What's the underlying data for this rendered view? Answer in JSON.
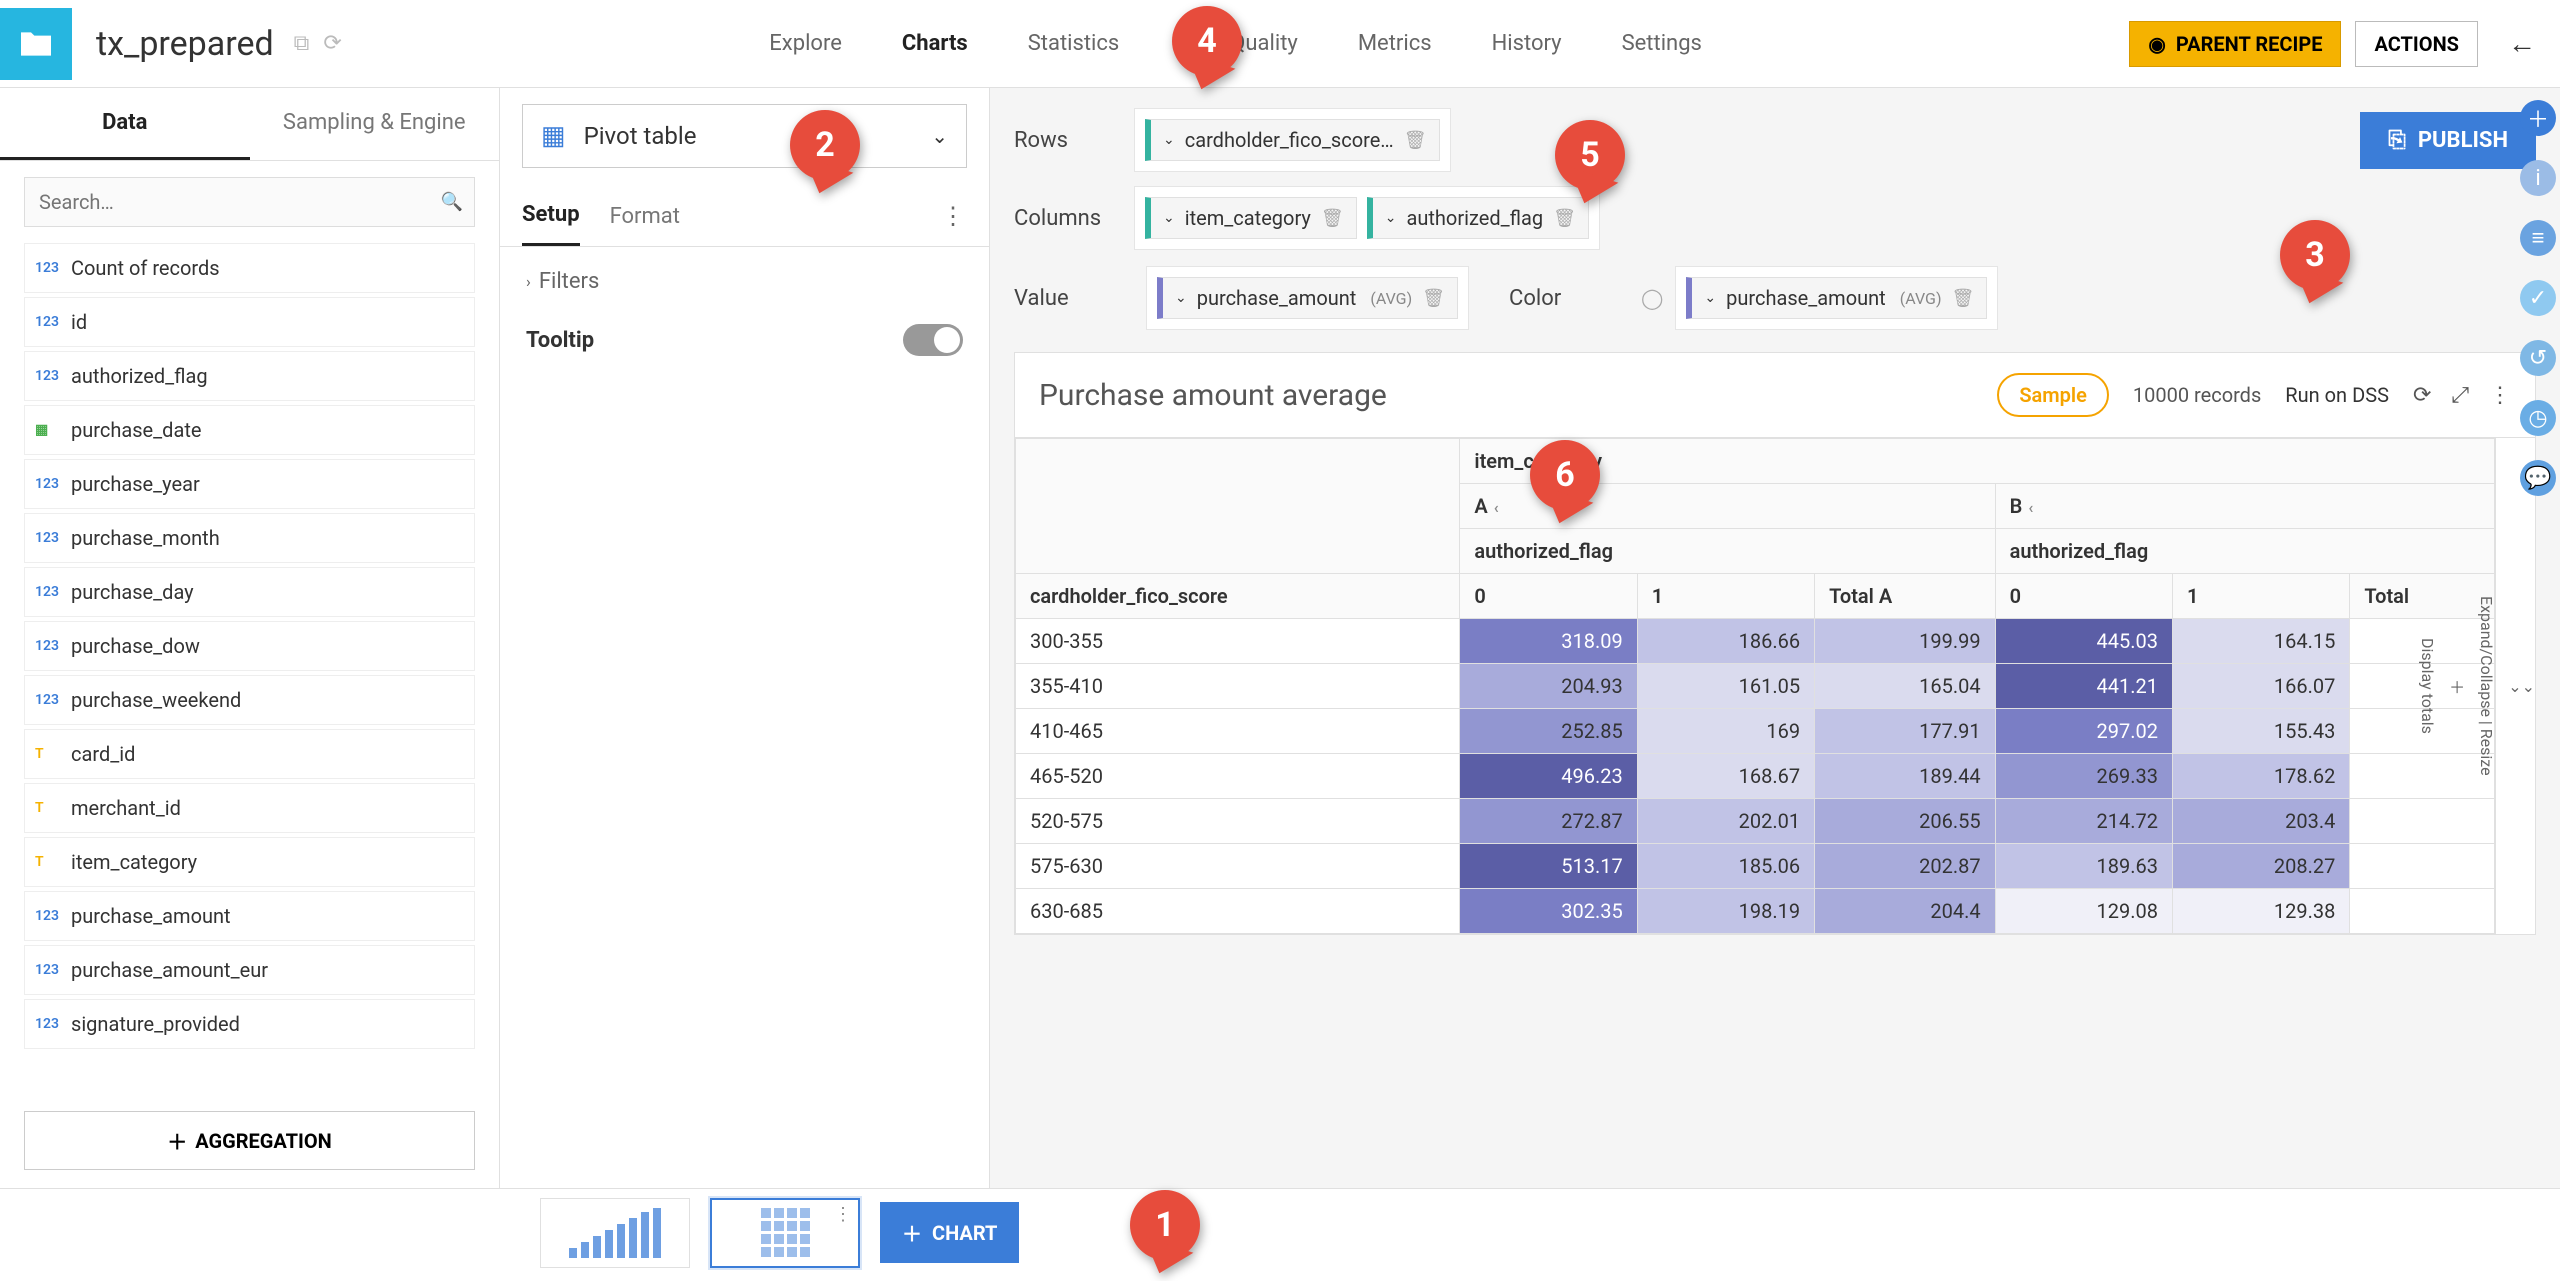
{
  "topbar": {
    "title": "tx_prepared",
    "nav": [
      "Explore",
      "Charts",
      "Statistics",
      "Data Quality",
      "Metrics",
      "History",
      "Settings"
    ],
    "active_nav": "Charts",
    "parent_recipe": "PARENT RECIPE",
    "actions": "ACTIONS"
  },
  "sidebar": {
    "tabs": [
      "Data",
      "Sampling & Engine"
    ],
    "active_tab": "Data",
    "search_placeholder": "Search…",
    "fields": [
      {
        "type": "num",
        "name": "Count of records"
      },
      {
        "type": "num",
        "name": "id"
      },
      {
        "type": "num",
        "name": "authorized_flag"
      },
      {
        "type": "date",
        "name": "purchase_date"
      },
      {
        "type": "num",
        "name": "purchase_year"
      },
      {
        "type": "num",
        "name": "purchase_month"
      },
      {
        "type": "num",
        "name": "purchase_day"
      },
      {
        "type": "num",
        "name": "purchase_dow"
      },
      {
        "type": "num",
        "name": "purchase_weekend"
      },
      {
        "type": "text",
        "name": "card_id"
      },
      {
        "type": "text",
        "name": "merchant_id"
      },
      {
        "type": "text",
        "name": "item_category"
      },
      {
        "type": "num",
        "name": "purchase_amount"
      },
      {
        "type": "num",
        "name": "purchase_amount_eur"
      },
      {
        "type": "num",
        "name": "signature_provided"
      }
    ],
    "aggregation_btn": "AGGREGATION"
  },
  "config": {
    "chart_type": "Pivot table",
    "subtabs": [
      "Setup",
      "Format"
    ],
    "active_subtab": "Setup",
    "filters_label": "Filters",
    "tooltip_label": "Tooltip"
  },
  "dims": {
    "rows_label": "Rows",
    "columns_label": "Columns",
    "value_label": "Value",
    "color_label": "Color",
    "rows_chip": "cardholder_fico_score…",
    "col_chips": [
      "item_category",
      "authorized_flag"
    ],
    "value_chip": "purchase_amount",
    "value_agg": "(AVG)",
    "color_chip": "purchase_amount",
    "color_agg": "(AVG)",
    "publish": "PUBLISH"
  },
  "result": {
    "title": "Purchase amount average",
    "sample_btn": "Sample",
    "records": "10000 records",
    "runon": "Run on DSS"
  },
  "pivot": {
    "col_group_label": "item_category",
    "col_groups": [
      "A",
      "B"
    ],
    "sub_col_label": "authorized_flag",
    "sub_cols": [
      "0",
      "1",
      "Total A",
      "0",
      "1",
      "Total"
    ],
    "row_label": "cardholder_fico_score",
    "rows": [
      {
        "label": "300-355",
        "vals": [
          318.09,
          186.66,
          199.99,
          445.03,
          164.15
        ]
      },
      {
        "label": "355-410",
        "vals": [
          204.93,
          161.05,
          165.04,
          441.21,
          166.07
        ]
      },
      {
        "label": "410-465",
        "vals": [
          252.85,
          169,
          177.91,
          297.02,
          155.43
        ]
      },
      {
        "label": "465-520",
        "vals": [
          496.23,
          168.67,
          189.44,
          269.33,
          178.62
        ]
      },
      {
        "label": "520-575",
        "vals": [
          272.87,
          202.01,
          206.55,
          214.72,
          203.4
        ]
      },
      {
        "label": "575-630",
        "vals": [
          513.17,
          185.06,
          202.87,
          189.63,
          208.27
        ]
      },
      {
        "label": "630-685",
        "vals": [
          302.35,
          198.19,
          204.4,
          129.08,
          129.38
        ]
      }
    ],
    "side_expand": "Expand/Collapse | Resize",
    "side_display": "Display totals"
  },
  "bottom": {
    "add_chart": "CHART"
  },
  "callouts": {
    "1": "1",
    "2": "2",
    "3": "3",
    "4": "4",
    "5": "5",
    "6": "6"
  },
  "chart_data": {
    "type": "table",
    "title": "Purchase amount average",
    "row_dimension": "cardholder_fico_score",
    "column_dimensions": [
      "item_category",
      "authorized_flag"
    ],
    "measure": "purchase_amount (AVG)",
    "color_measure": "purchase_amount (AVG)",
    "column_groups": [
      {
        "item_category": "A",
        "authorized_flag_levels": [
          "0",
          "1",
          "Total A"
        ]
      },
      {
        "item_category": "B",
        "authorized_flag_levels": [
          "0",
          "1",
          "Total"
        ]
      }
    ],
    "data": [
      {
        "row": "300-355",
        "A_0": 318.09,
        "A_1": 186.66,
        "A_total": 199.99,
        "B_0": 445.03,
        "B_1": 164.15
      },
      {
        "row": "355-410",
        "A_0": 204.93,
        "A_1": 161.05,
        "A_total": 165.04,
        "B_0": 441.21,
        "B_1": 166.07
      },
      {
        "row": "410-465",
        "A_0": 252.85,
        "A_1": 169,
        "A_total": 177.91,
        "B_0": 297.02,
        "B_1": 155.43
      },
      {
        "row": "465-520",
        "A_0": 496.23,
        "A_1": 168.67,
        "A_total": 189.44,
        "B_0": 269.33,
        "B_1": 178.62
      },
      {
        "row": "520-575",
        "A_0": 272.87,
        "A_1": 202.01,
        "A_total": 206.55,
        "B_0": 214.72,
        "B_1": 203.4
      },
      {
        "row": "575-630",
        "A_0": 513.17,
        "A_1": 185.06,
        "A_total": 202.87,
        "B_0": 189.63,
        "B_1": 208.27
      },
      {
        "row": "630-685",
        "A_0": 302.35,
        "A_1": 198.19,
        "A_total": 204.4,
        "B_0": 129.08,
        "B_1": 129.38
      }
    ]
  }
}
